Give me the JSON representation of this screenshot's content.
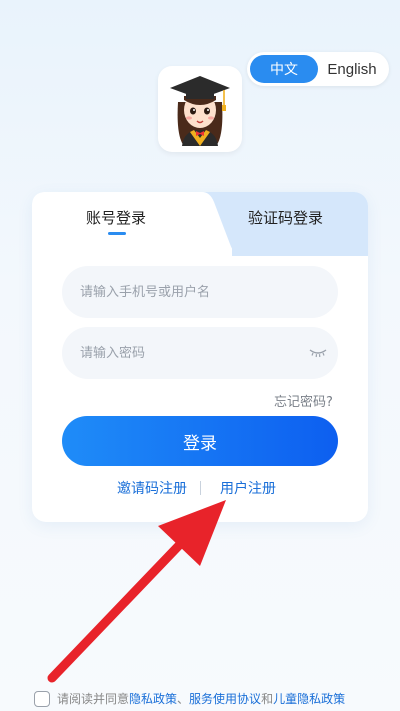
{
  "lang": {
    "zh": "中文",
    "en": "English"
  },
  "tabs": {
    "account": "账号登录",
    "code": "验证码登录"
  },
  "inputs": {
    "phone_placeholder": "请输入手机号或用户名",
    "password_placeholder": "请输入密码"
  },
  "forgot_label": "忘记密码?",
  "login_label": "登录",
  "links": {
    "invite": "邀请码注册",
    "user": "用户注册"
  },
  "agreement": {
    "prefix": "请阅读并同意",
    "privacy": "隐私政策",
    "sep1": "、",
    "service": "服务使用协议",
    "and": "和",
    "child": "儿童隐私政策"
  },
  "colors": {
    "accent": "#2a8cf0",
    "arrow": "#e8232a"
  }
}
